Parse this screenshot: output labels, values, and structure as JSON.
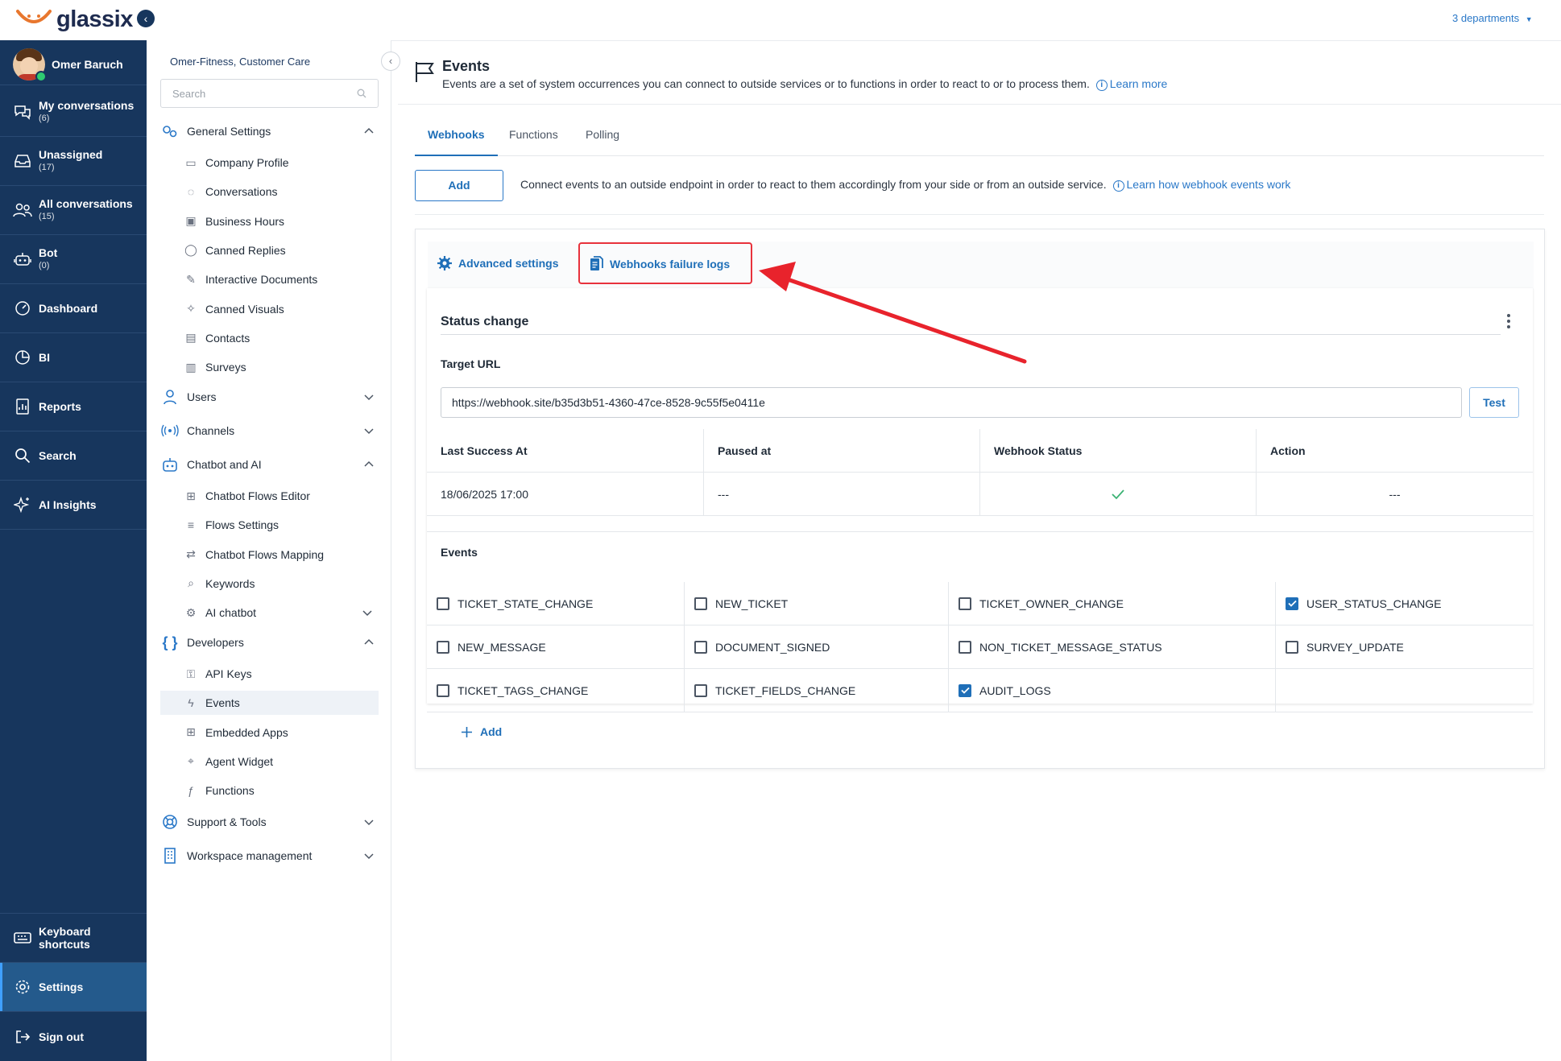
{
  "app": {
    "brand": "glassix",
    "departments": "3 departments"
  },
  "user": {
    "name": "Omer Baruch"
  },
  "left_nav": [
    {
      "key": "my",
      "label": "My conversations",
      "count": "(6)",
      "icon": "chat-bubbles-icon"
    },
    {
      "key": "unassigned",
      "label": "Unassigned",
      "count": "(17)",
      "icon": "inbox-icon"
    },
    {
      "key": "all",
      "label": "All conversations",
      "count": "(15)",
      "icon": "people-icon"
    },
    {
      "key": "bot",
      "label": "Bot",
      "count": "(0)",
      "icon": "robot-icon"
    },
    {
      "key": "dashboard",
      "label": "Dashboard",
      "count": "",
      "icon": "gauge-icon"
    },
    {
      "key": "bi",
      "label": "BI",
      "count": "",
      "icon": "pie-chart-icon"
    },
    {
      "key": "reports",
      "label": "Reports",
      "count": "",
      "icon": "report-icon"
    },
    {
      "key": "search",
      "label": "Search",
      "count": "",
      "icon": "search-icon"
    },
    {
      "key": "ai",
      "label": "AI Insights",
      "count": "",
      "icon": "sparkle-icon"
    }
  ],
  "left_nav_bottom": {
    "keyboard": "Keyboard shortcuts",
    "settings": "Settings",
    "signout": "Sign out"
  },
  "settings": {
    "org": "Omer-Fitness, Customer Care",
    "search_placeholder": "Search",
    "groups": {
      "general": "General Settings",
      "users": "Users",
      "channels": "Channels",
      "chatbot": "Chatbot and AI",
      "developers": "Developers",
      "support": "Support & Tools",
      "workspace": "Workspace management"
    },
    "general_items": [
      "Company Profile",
      "Conversations",
      "Business Hours",
      "Canned Replies",
      "Interactive Documents",
      "Canned Visuals",
      "Contacts",
      "Surveys"
    ],
    "chatbot_items": [
      "Chatbot Flows Editor",
      "Flows Settings",
      "Chatbot Flows Mapping",
      "Keywords",
      "AI chatbot"
    ],
    "developer_items": [
      "API Keys",
      "Events",
      "Embedded Apps",
      "Agent Widget",
      "Functions"
    ]
  },
  "page": {
    "title": "Events",
    "description": "Events are a set of system occurrences you can connect to outside services or to functions in order to react to or to process them.",
    "learn_more": "Learn more",
    "tabs": [
      "Webhooks",
      "Functions",
      "Polling"
    ],
    "add_label": "Add",
    "add_description": "Connect events to an outside endpoint in order to react to them accordingly from your side or from an outside service.",
    "add_link": "Learn how webhook events work",
    "subtabs": {
      "advanced": "Advanced settings",
      "failure_logs": "Webhooks failure logs"
    }
  },
  "webhook": {
    "title": "Status change",
    "target_label": "Target URL",
    "target_url": "https://webhook.site/b35d3b51-4360-47ce-8528-9c55f5e0411e",
    "test_label": "Test",
    "columns": [
      "Last Success At",
      "Paused at",
      "Webhook Status",
      "Action"
    ],
    "row": {
      "last_success": "18/06/2025 17:00",
      "paused_at": "---",
      "status": "ok",
      "action": "---"
    },
    "events_label": "Events",
    "events": [
      {
        "name": "TICKET_STATE_CHANGE",
        "checked": false
      },
      {
        "name": "NEW_TICKET",
        "checked": false
      },
      {
        "name": "TICKET_OWNER_CHANGE",
        "checked": false
      },
      {
        "name": "USER_STATUS_CHANGE",
        "checked": true
      },
      {
        "name": "NEW_MESSAGE",
        "checked": false
      },
      {
        "name": "DOCUMENT_SIGNED",
        "checked": false
      },
      {
        "name": "NON_TICKET_MESSAGE_STATUS",
        "checked": false
      },
      {
        "name": "SURVEY_UPDATE",
        "checked": false
      },
      {
        "name": "TICKET_TAGS_CHANGE",
        "checked": false
      },
      {
        "name": "TICKET_FIELDS_CHANGE",
        "checked": false
      },
      {
        "name": "AUDIT_LOGS",
        "checked": true
      }
    ],
    "add_event_label": "Add"
  },
  "colors": {
    "nav_bg": "#17365d",
    "accent": "#1f6fb8",
    "highlight": "#e8323c",
    "success": "#3bb273"
  }
}
